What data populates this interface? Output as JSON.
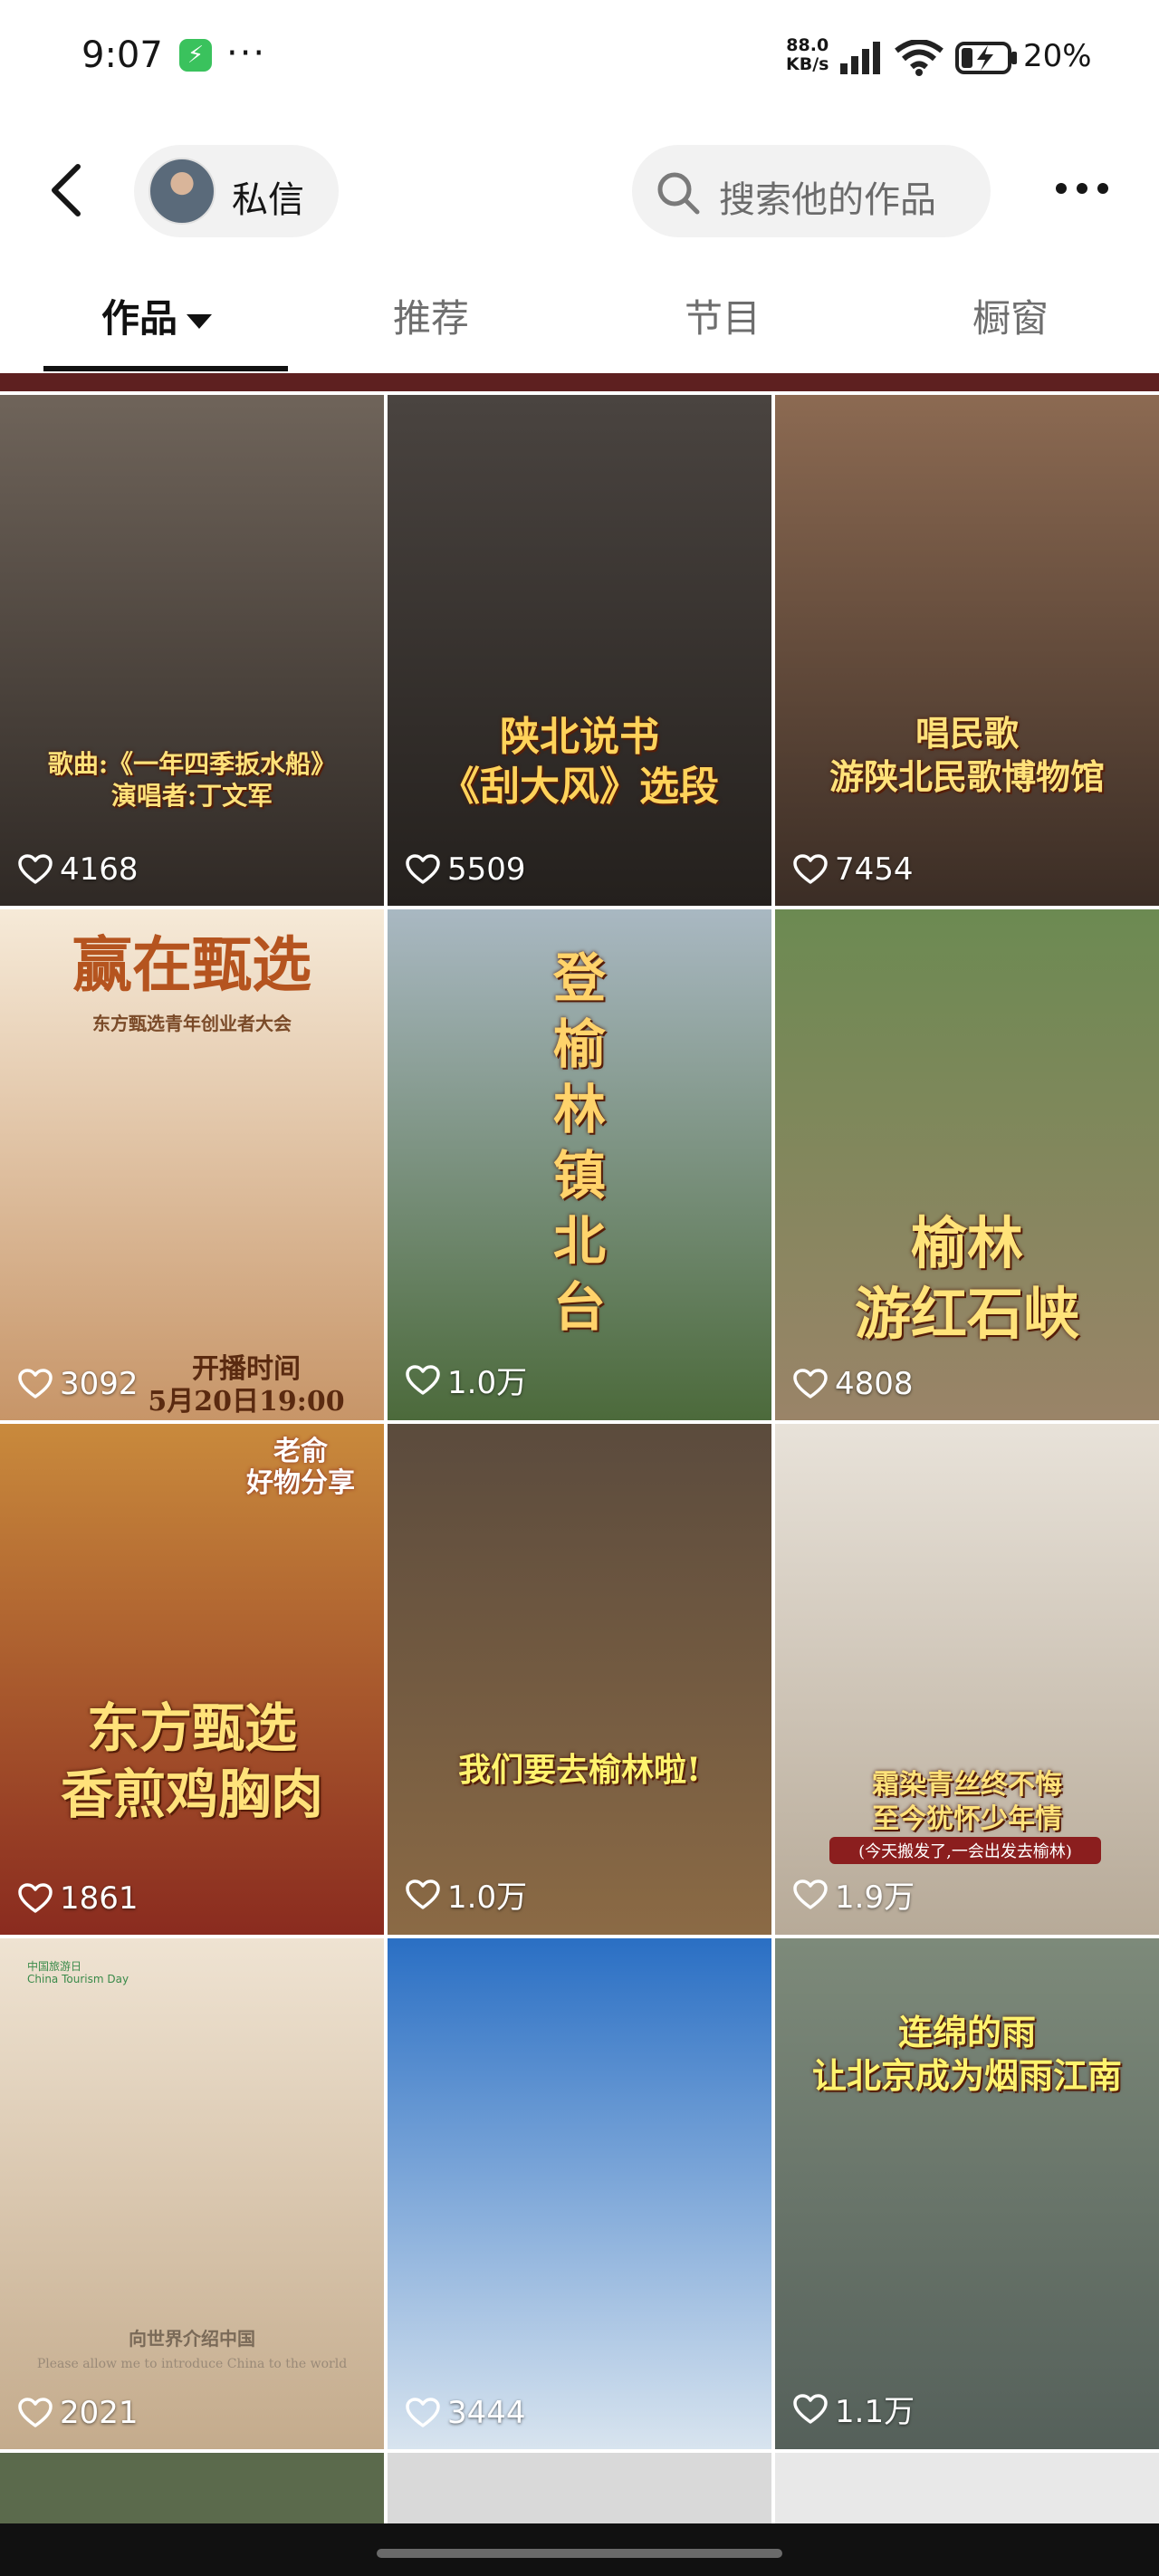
{
  "status_bar": {
    "time": "9:07",
    "app_icon": "lightning-icon",
    "more": "···",
    "net_speed_value": "88.0",
    "net_speed_unit": "KB/s",
    "battery": "20%"
  },
  "header": {
    "dm_label": "私信",
    "search_placeholder": "搜索他的作品"
  },
  "tabs": [
    {
      "label": "作品"
    },
    {
      "label": "推荐"
    },
    {
      "label": "节目"
    },
    {
      "label": "橱窗"
    }
  ],
  "videos": [
    {
      "likes": "4168",
      "overlay": "歌曲:《一年四季扳水船》\n演唱者:丁文军",
      "colors": [
        "#6f645a",
        "#2f2925"
      ]
    },
    {
      "likes": "5509",
      "overlay": "陕北说书\n《刮大风》选段",
      "colors": [
        "#4a4440",
        "#24201d"
      ]
    },
    {
      "likes": "7454",
      "overlay": "唱民歌\n游陕北民歌博物馆",
      "colors": [
        "#8c6a52",
        "#3b2d25"
      ]
    },
    {
      "likes": "3092",
      "overlay": "赢在甄选",
      "subtitle": "东方甄选青年创业者大会",
      "footer": "开播时间\n5月20日19:00",
      "colors": [
        "#f6ead8",
        "#c79568"
      ]
    },
    {
      "likes": "1.0万",
      "overlay": "登榆林镇北台",
      "colors": [
        "#a9b8c2",
        "#4c6a3b"
      ]
    },
    {
      "likes": "4808",
      "overlay": "榆林\n游红石峡",
      "colors": [
        "#6c8a52",
        "#9a8468"
      ]
    },
    {
      "likes": "1861",
      "overlay": "东方甄选\n香煎鸡胸肉",
      "badge": "老俞\n好物分享",
      "colors": [
        "#c98a3c",
        "#8a2b1f"
      ]
    },
    {
      "likes": "1.0万",
      "overlay": "我们要去榆林啦!",
      "colors": [
        "#5b4b3d",
        "#8b6a45"
      ]
    },
    {
      "likes": "1.9万",
      "overlay": "霜染青丝终不悔\n至今犹怀少年情",
      "caption": "(今天搬发了,一会出发去榆林)",
      "colors": [
        "#e8e2d9",
        "#b7aa98"
      ]
    },
    {
      "likes": "2021",
      "overlay": "向世界介绍中国",
      "caption": "Please allow me to introduce China to the world",
      "logo": "中国旅游日\nChina Tourism Day",
      "colors": [
        "#efe3d2",
        "#c4ab8c"
      ]
    },
    {
      "likes": "3444",
      "overlay": "",
      "colors": [
        "#2a6fc4",
        "#d8e4ef"
      ]
    },
    {
      "likes": "1.1万",
      "overlay": "连绵的雨\n让北京成为烟雨江南",
      "colors": [
        "#7d8a7a",
        "#55605a"
      ]
    }
  ],
  "theme": {
    "accent": "#111111",
    "muted_tab": "#6e6e6e",
    "pill_bg": "#f2f2f2"
  }
}
